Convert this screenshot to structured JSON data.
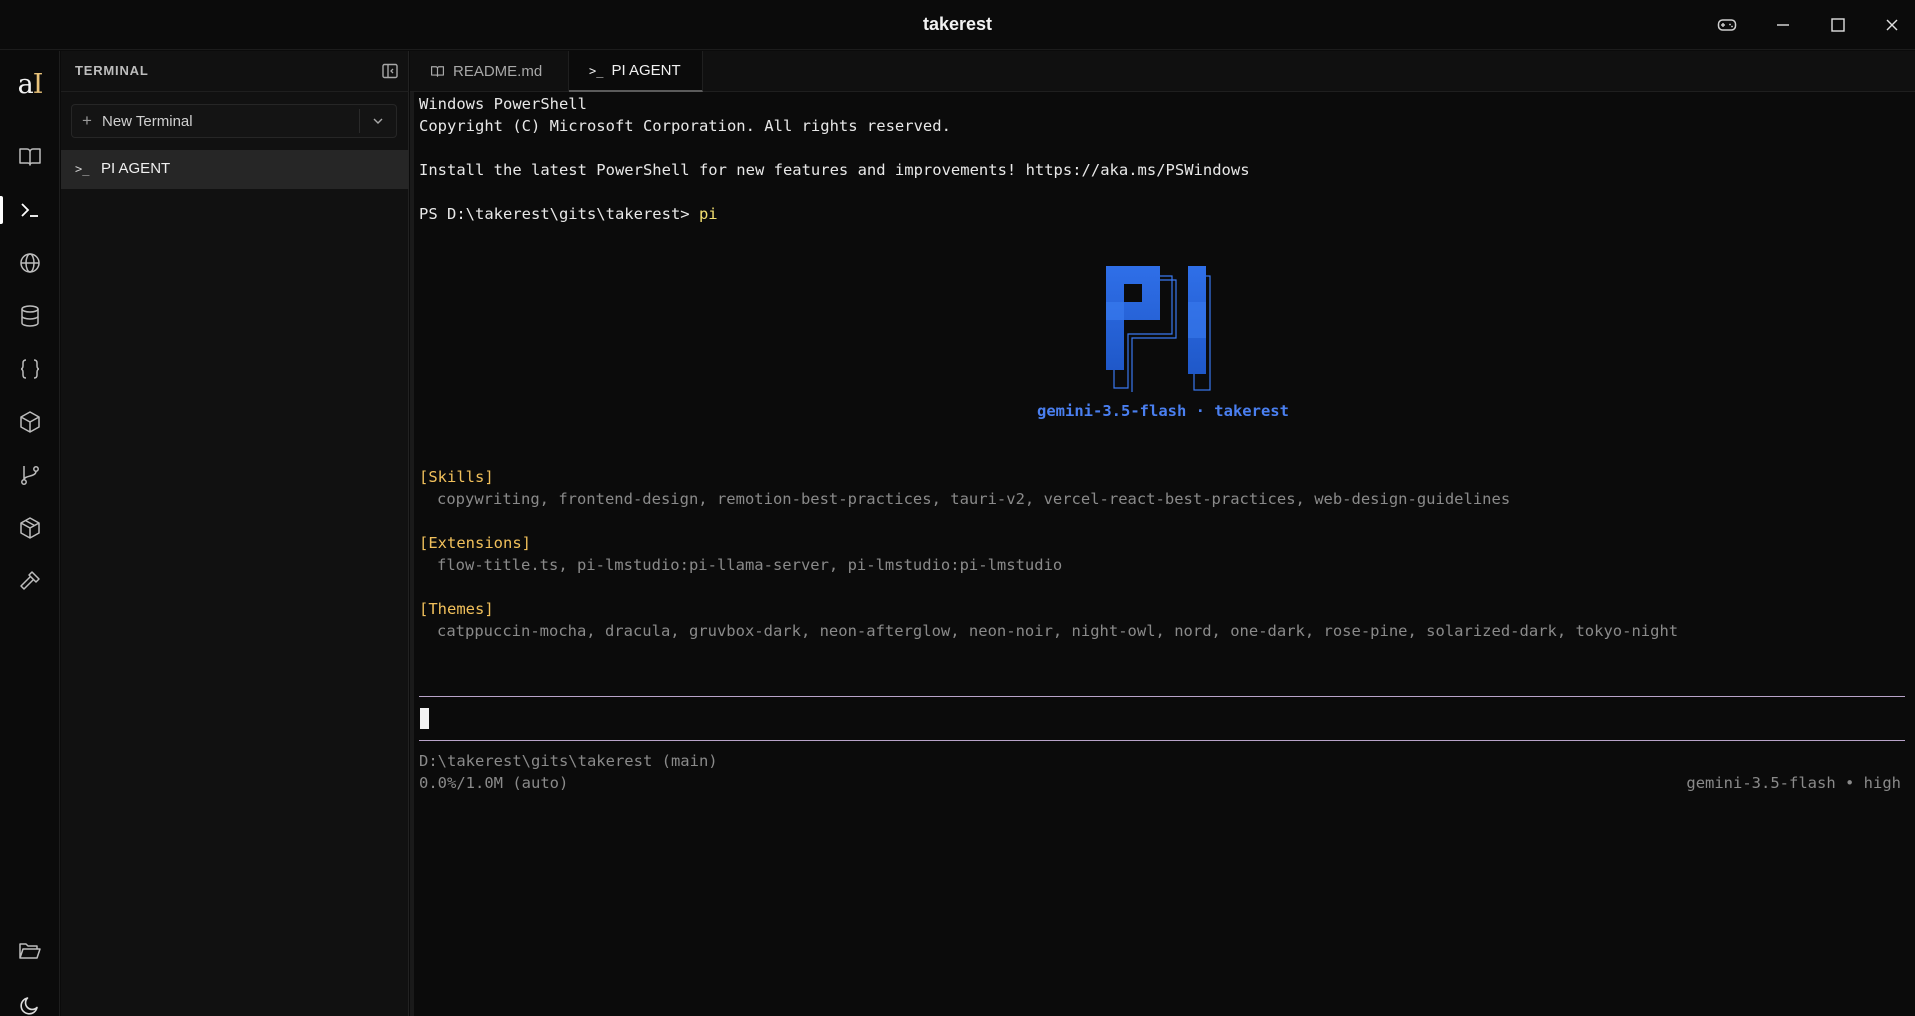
{
  "window": {
    "title": "takerest"
  },
  "activity_bar": {
    "logo": {
      "main": "a",
      "accent": "I"
    },
    "items": [
      "book-icon",
      "terminal-icon",
      "globe-icon",
      "database-icon",
      "braces-icon",
      "cube-icon",
      "git-branch-icon",
      "package-icon",
      "hammer-icon"
    ],
    "bottom_items": [
      "folder-open-icon",
      "moon-icon"
    ]
  },
  "sidebar": {
    "title": "TERMINAL",
    "new_terminal_label": "New Terminal",
    "items": [
      {
        "icon": ">_",
        "label": "PI AGENT"
      }
    ]
  },
  "tabs": [
    {
      "label": "README.md",
      "icon": "book-icon",
      "active": false
    },
    {
      "label": "PI AGENT",
      "icon": ">_",
      "active": true
    }
  ],
  "terminal": {
    "lines": {
      "l1": "Windows PowerShell",
      "l2": "Copyright (C) Microsoft Corporation. All rights reserved.",
      "l3": "Install the latest PowerShell for new features and improvements! https://aka.ms/PSWindows",
      "prompt": "PS D:\\takerest\\gits\\takerest> ",
      "command": "pi"
    },
    "banner_logo_text": "PI",
    "banner_subtitle": "gemini-3.5-flash · takerest",
    "sections": [
      {
        "heading": "[Skills]",
        "content": "copywriting, frontend-design, remotion-best-practices, tauri-v2, vercel-react-best-practices, web-design-guidelines"
      },
      {
        "heading": "[Extensions]",
        "content": "flow-title.ts, pi-lmstudio:pi-llama-server, pi-lmstudio:pi-lmstudio"
      },
      {
        "heading": "[Themes]",
        "content": "catppuccin-mocha, dracula, gruvbox-dark, neon-afterglow, neon-noir, night-owl, nord, one-dark, rose-pine, solarized-dark, tokyo-night"
      }
    ],
    "status": {
      "path": "D:\\takerest\\gits\\takerest (main)",
      "usage": "0.0%/1.0M (auto)",
      "model": "gemini-3.5-flash • high"
    }
  },
  "colors": {
    "accent_blue": "#2f6fe8",
    "heading_yellow": "#f1c05b",
    "rule_lavender": "#b9a4c9"
  }
}
